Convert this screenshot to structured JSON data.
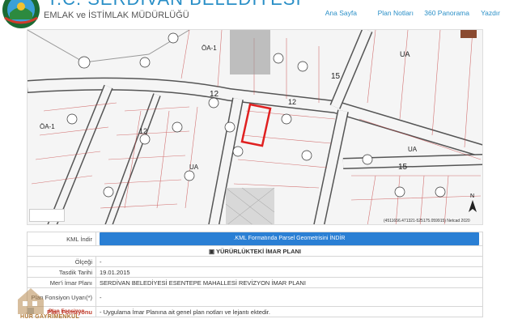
{
  "header": {
    "title": "T.C. SERDİVAN BELEDİYESİ",
    "subtitle": "EMLAK ve İSTİMLAK MÜDÜRLÜĞÜ",
    "nav": [
      "Ana Sayfa",
      "Plan Notları",
      "360 Panorama",
      "Yazdır"
    ]
  },
  "map": {
    "labels": [
      "ÖA-1",
      "UA",
      "ÖA-1",
      "UA",
      "UA",
      "12",
      "12",
      "12",
      "15",
      "15",
      "N"
    ],
    "coordinates": "(4511656.471321-525175.059915) Netcad 2020"
  },
  "rows": {
    "kml_label": "KML İndir",
    "kml_button": ".KML Formatında Parsel Geometrisini İNDİR",
    "section_title": "YÜRÜRLÜKTEKİ İMAR PLANI",
    "olcegi_label": "Ölçeği",
    "olcegi_value": "-",
    "tasdik_label": "Tasdik Tarihi",
    "tasdik_value": "19.01.2015",
    "plan_adi_label": "Mer'i İmar Planı",
    "plan_adi_value": "SERDİVAN BELEDİYESİ ESENTEPE MAHALLESİ REVİZYON İMAR PLANI",
    "uyari_label": "Plan Fonsiyon Uyarı(*)",
    "uyari_value": "-",
    "fonsiyon_label": "Plan Fonsiyonu",
    "fonsiyon_value": "- Uygulama İmar Planına ait genel plan notları ve lejantı ektedir."
  },
  "watermark": {
    "line1": "Plan Fonsiyon",
    "line2": "HÜR GAYRİMENKUL"
  },
  "colors": {
    "accent": "#2a8fc7",
    "button": "#2a7fd4",
    "parcel_highlight": "#e02020"
  }
}
